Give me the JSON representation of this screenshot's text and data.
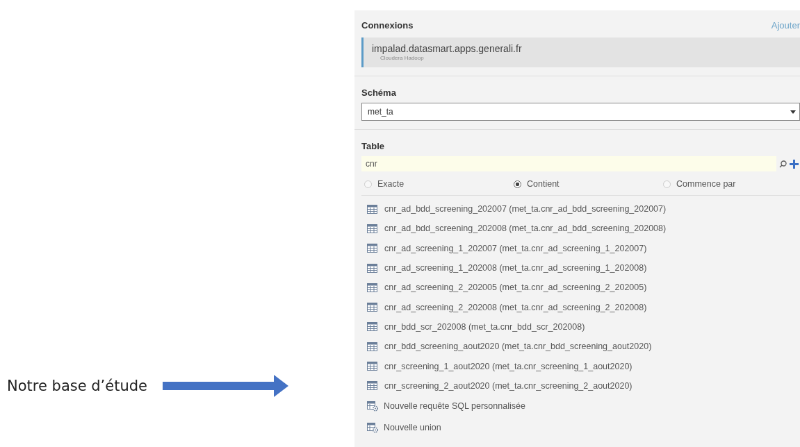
{
  "annotation": {
    "text": "Notre base d’étude"
  },
  "connections": {
    "label": "Connexions",
    "add_link": "Ajouter",
    "items": [
      {
        "name": "impalad.datasmart.apps.generali.fr",
        "type": "Cloudera Hadoop",
        "selected": true
      }
    ]
  },
  "schema": {
    "label": "Schéma",
    "value": "met_ta"
  },
  "table": {
    "label": "Table",
    "search": {
      "value": "cnr"
    },
    "match_options": [
      {
        "label": "Exacte",
        "selected": false
      },
      {
        "label": "Contient",
        "selected": true
      },
      {
        "label": "Commence par",
        "selected": false
      }
    ],
    "items": [
      {
        "kind": "table",
        "label": "cnr_ad_bdd_screening_202007 (met_ta.cnr_ad_bdd_screening_202007)"
      },
      {
        "kind": "table",
        "label": "cnr_ad_bdd_screening_202008 (met_ta.cnr_ad_bdd_screening_202008)"
      },
      {
        "kind": "table",
        "label": "cnr_ad_screening_1_202007 (met_ta.cnr_ad_screening_1_202007)"
      },
      {
        "kind": "table",
        "label": "cnr_ad_screening_1_202008 (met_ta.cnr_ad_screening_1_202008)"
      },
      {
        "kind": "table",
        "label": "cnr_ad_screening_2_202005 (met_ta.cnr_ad_screening_2_202005)"
      },
      {
        "kind": "table",
        "label": "cnr_ad_screening_2_202008 (met_ta.cnr_ad_screening_2_202008)"
      },
      {
        "kind": "table",
        "label": "cnr_bdd_scr_202008 (met_ta.cnr_bdd_scr_202008)"
      },
      {
        "kind": "table",
        "label": "cnr_bdd_screening_aout2020 (met_ta.cnr_bdd_screening_aout2020)"
      },
      {
        "kind": "table",
        "label": "cnr_screening_1_aout2020 (met_ta.cnr_screening_1_aout2020)"
      },
      {
        "kind": "table",
        "label": "cnr_screening_2_aout2020 (met_ta.cnr_screening_2_aout2020)",
        "annotated": true
      },
      {
        "kind": "action",
        "label": "Nouvelle requête SQL personnalisée"
      },
      {
        "kind": "action",
        "label": "Nouvelle union"
      }
    ]
  }
}
